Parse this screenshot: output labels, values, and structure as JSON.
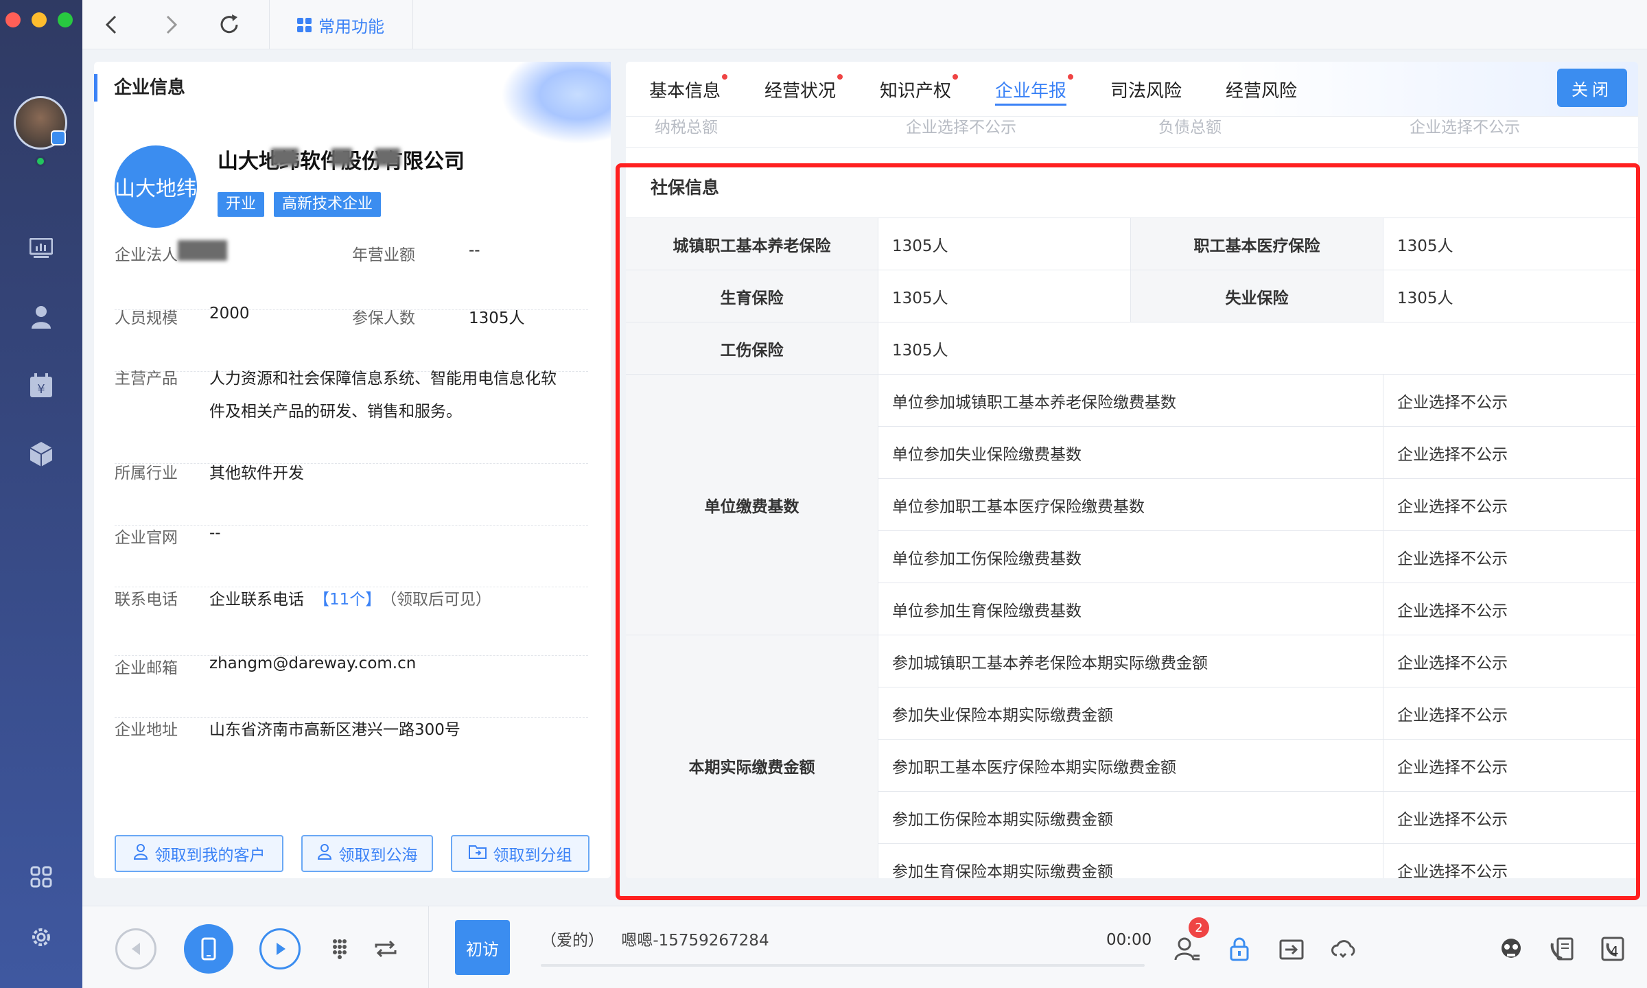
{
  "window": {
    "traffic_lights": [
      "#ff5f57",
      "#febc2e",
      "#28c840"
    ]
  },
  "topbar": {
    "back_icon": "chevron-left-icon",
    "forward_icon": "chevron-right-icon",
    "refresh_icon": "refresh-icon",
    "common_tab": "常用功能"
  },
  "sidebar": {
    "items": [
      "dashboard-icon",
      "contacts-icon",
      "billing-icon",
      "cube-icon",
      "apps-icon",
      "settings-icon"
    ]
  },
  "company": {
    "section_title": "企业信息",
    "logo_text": "山大地纬",
    "name": "山大地纬软件股份有限公司",
    "tags": [
      "开业",
      "高新技术企业"
    ],
    "legal_label": "企业法人",
    "revenue_label": "年营业额",
    "revenue_value": "--",
    "staff_label": "人员规模",
    "staff_value": "2000",
    "insured_label": "参保人数",
    "insured_value": "1305人",
    "product_label": "主营产品",
    "product_line1": "人力资源和社会保障信息系统、智能用电信息化软",
    "product_line2": "件及相关产品的研发、销售和服务。",
    "industry_label": "所属行业",
    "industry_value": "其他软件开发",
    "website_label": "企业官网",
    "website_value": "--",
    "phone_label": "联系电话",
    "phone_value": "企业联系电话",
    "phone_count": "【11个】",
    "phone_note": "（领取后可见）",
    "email_label": "企业邮箱",
    "email_value": "zhangm@dareway.com.cn",
    "address_label": "企业地址",
    "address_value": "山东省济南市高新区港兴一路300号",
    "buttons": [
      "领取到我的客户",
      "领取到公海",
      "领取到分组"
    ]
  },
  "tabs": {
    "items": [
      "基本信息",
      "经营状况",
      "知识产权",
      "企业年报",
      "司法风险",
      "经营风险"
    ],
    "active": "企业年报",
    "close": "关闭"
  },
  "ghost_row": [
    "纳税总额",
    "企业选择不公示",
    "负债总额",
    "企业选择不公示"
  ],
  "social": {
    "title": "社保信息",
    "pension_label": "城镇职工基本养老保险",
    "pension_value": "1305人",
    "medical_label": "职工基本医疗保险",
    "medical_value": "1305人",
    "maternity_label": "生育保险",
    "maternity_value": "1305人",
    "unemployment_label": "失业保险",
    "unemployment_value": "1305人",
    "injury_label": "工伤保险",
    "injury_value": "1305人",
    "base_group": "单位缴费基数",
    "base_rows": [
      {
        "item": "单位参加城镇职工基本养老保险缴费基数",
        "value": "企业选择不公示"
      },
      {
        "item": "单位参加失业保险缴费基数",
        "value": "企业选择不公示"
      },
      {
        "item": "单位参加职工基本医疗保险缴费基数",
        "value": "企业选择不公示"
      },
      {
        "item": "单位参加工伤保险缴费基数",
        "value": "企业选择不公示"
      },
      {
        "item": "单位参加生育保险缴费基数",
        "value": "企业选择不公示"
      }
    ],
    "actual_group": "本期实际缴费金额",
    "actual_rows": [
      {
        "item": "参加城镇职工基本养老保险本期实际缴费金额",
        "value": "企业选择不公示"
      },
      {
        "item": "参加失业保险本期实际缴费金额",
        "value": "企业选择不公示"
      },
      {
        "item": "参加职工基本医疗保险本期实际缴费金额",
        "value": "企业选择不公示"
      },
      {
        "item": "参加工伤保险本期实际缴费金额",
        "value": "企业选择不公示"
      },
      {
        "item": "参加生育保险本期实际缴费金额",
        "value": "企业选择不公示"
      }
    ]
  },
  "callbar": {
    "visit": "初访",
    "caller_tag": "（爱的）",
    "caller": "嗯嗯-15759267284",
    "time": "00:00",
    "badge": "2",
    "line_count": "4"
  },
  "colors": {
    "accent": "#3b8df0",
    "highlight": "#ff2020",
    "sidebar": "#2f3a63"
  }
}
